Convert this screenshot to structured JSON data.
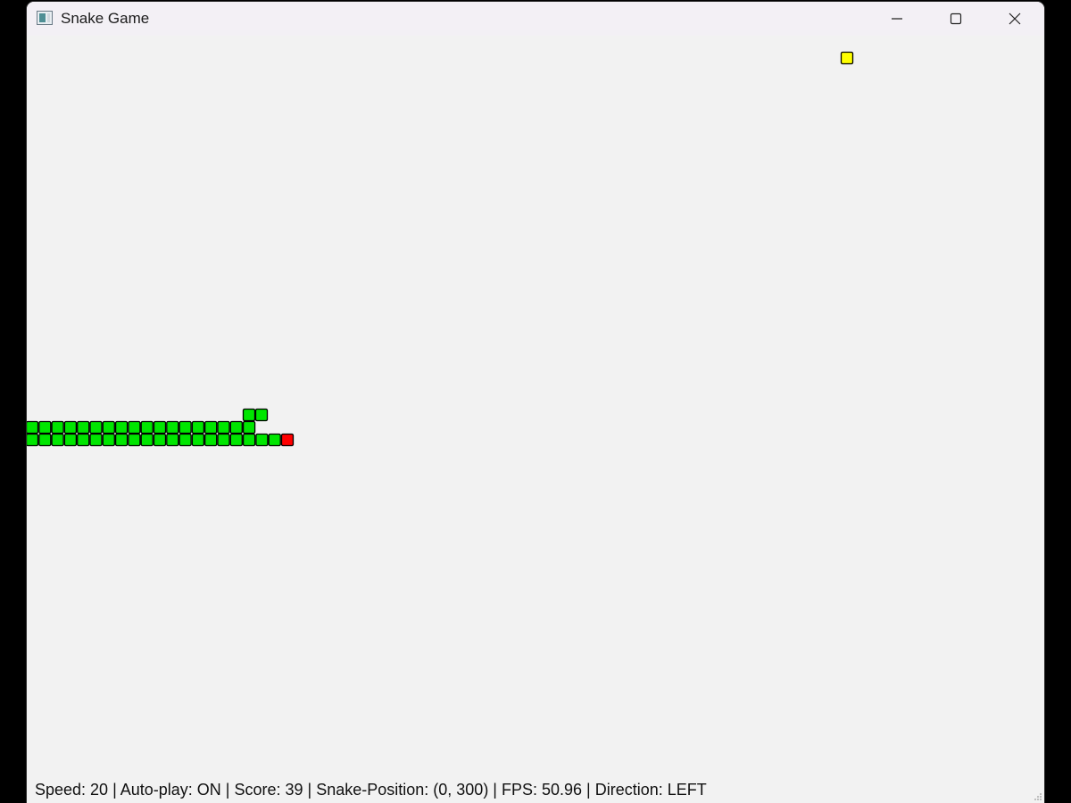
{
  "window": {
    "title": "Snake Game",
    "controls": {
      "minimize": "minimize-icon",
      "maximize": "maximize-icon",
      "close": "close-icon"
    }
  },
  "game": {
    "colors": {
      "snake_body": "#00e600",
      "snake_head": "#ff0000",
      "food": "#ffff00",
      "outline": "#000000",
      "background": "#f2f2f2"
    }
  },
  "status_bar": {
    "text": "Speed: 20 | Auto-play: ON | Score: 39 | Snake-Position: (0, 300) | FPS: 50.96 | Direction: LEFT"
  }
}
